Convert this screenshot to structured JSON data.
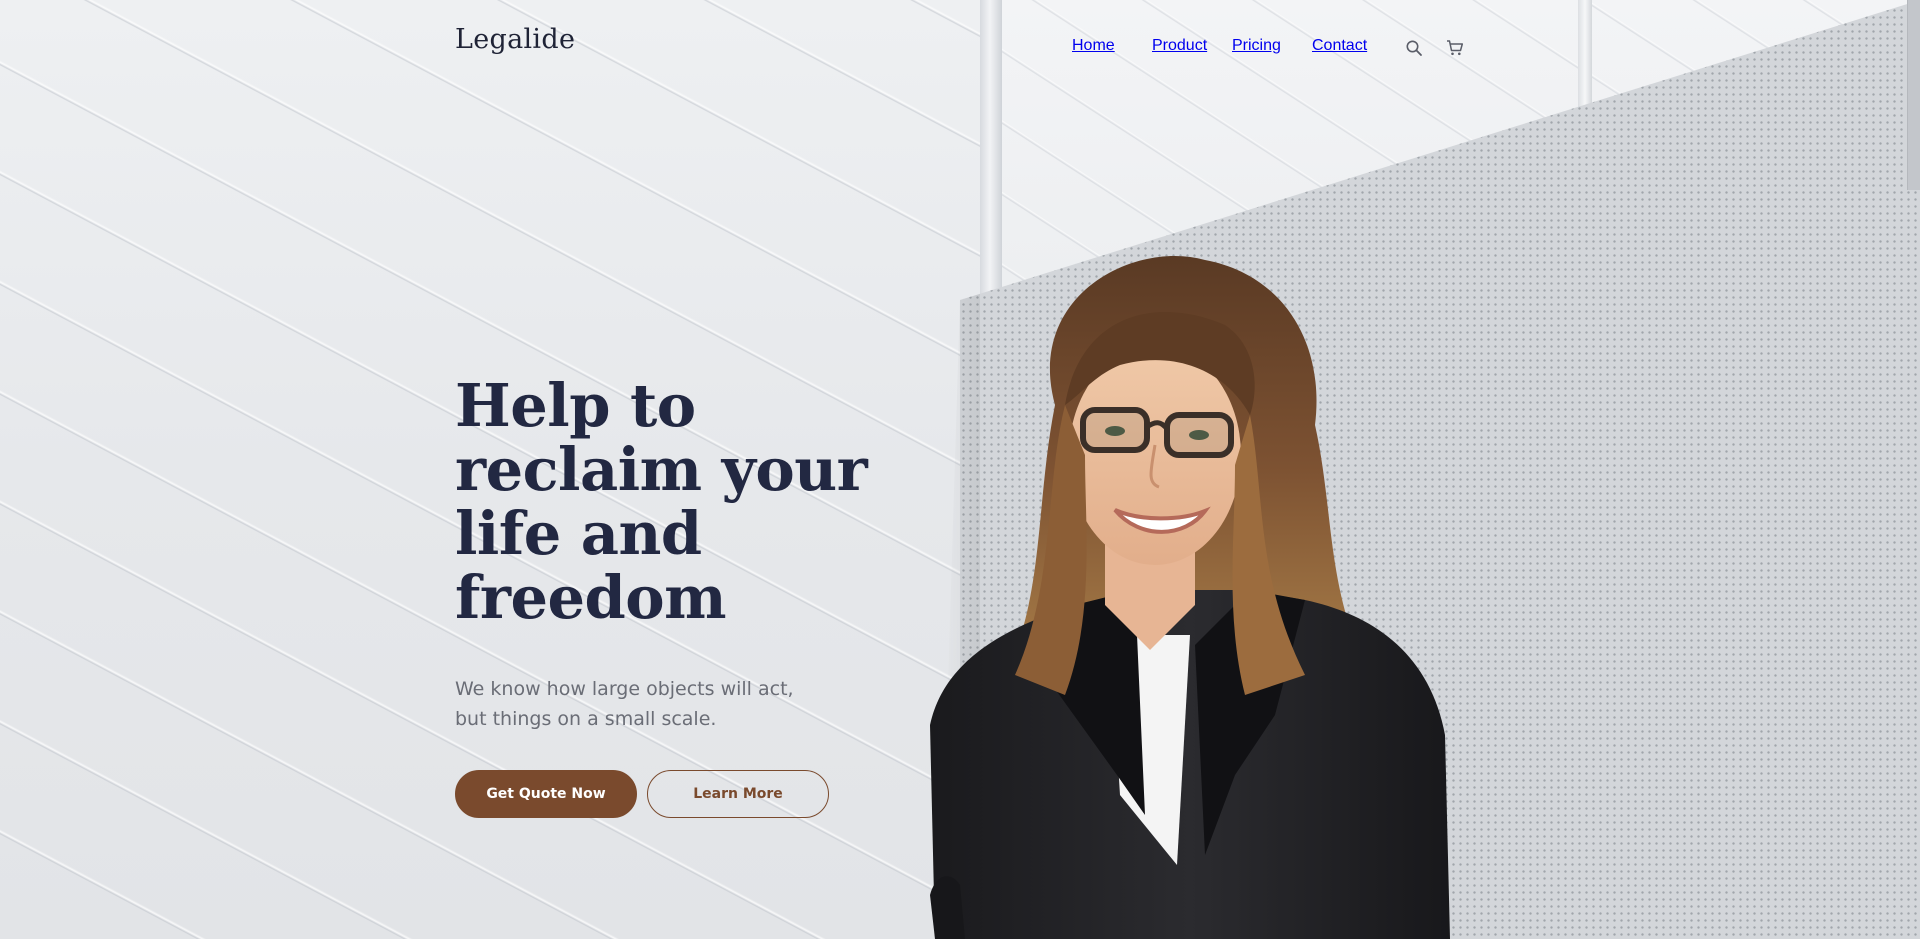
{
  "brand": {
    "name": "Legalide"
  },
  "nav": {
    "items": [
      {
        "label": "Home"
      },
      {
        "label": "Product"
      },
      {
        "label": "Pricing"
      },
      {
        "label": "Contact"
      }
    ],
    "icons": [
      "search-icon",
      "cart-icon"
    ]
  },
  "hero": {
    "title_lines": [
      "Help to",
      "reclaim your",
      "life and",
      "freedom"
    ],
    "subtitle_lines": [
      "We know how large objects will act,",
      "but things on a small scale."
    ],
    "primary_button": "Get Quote Now",
    "secondary_button": "Learn More"
  },
  "colors": {
    "accent": "#7a4a2d",
    "heading": "#222842",
    "body_text": "#6a6d76"
  }
}
